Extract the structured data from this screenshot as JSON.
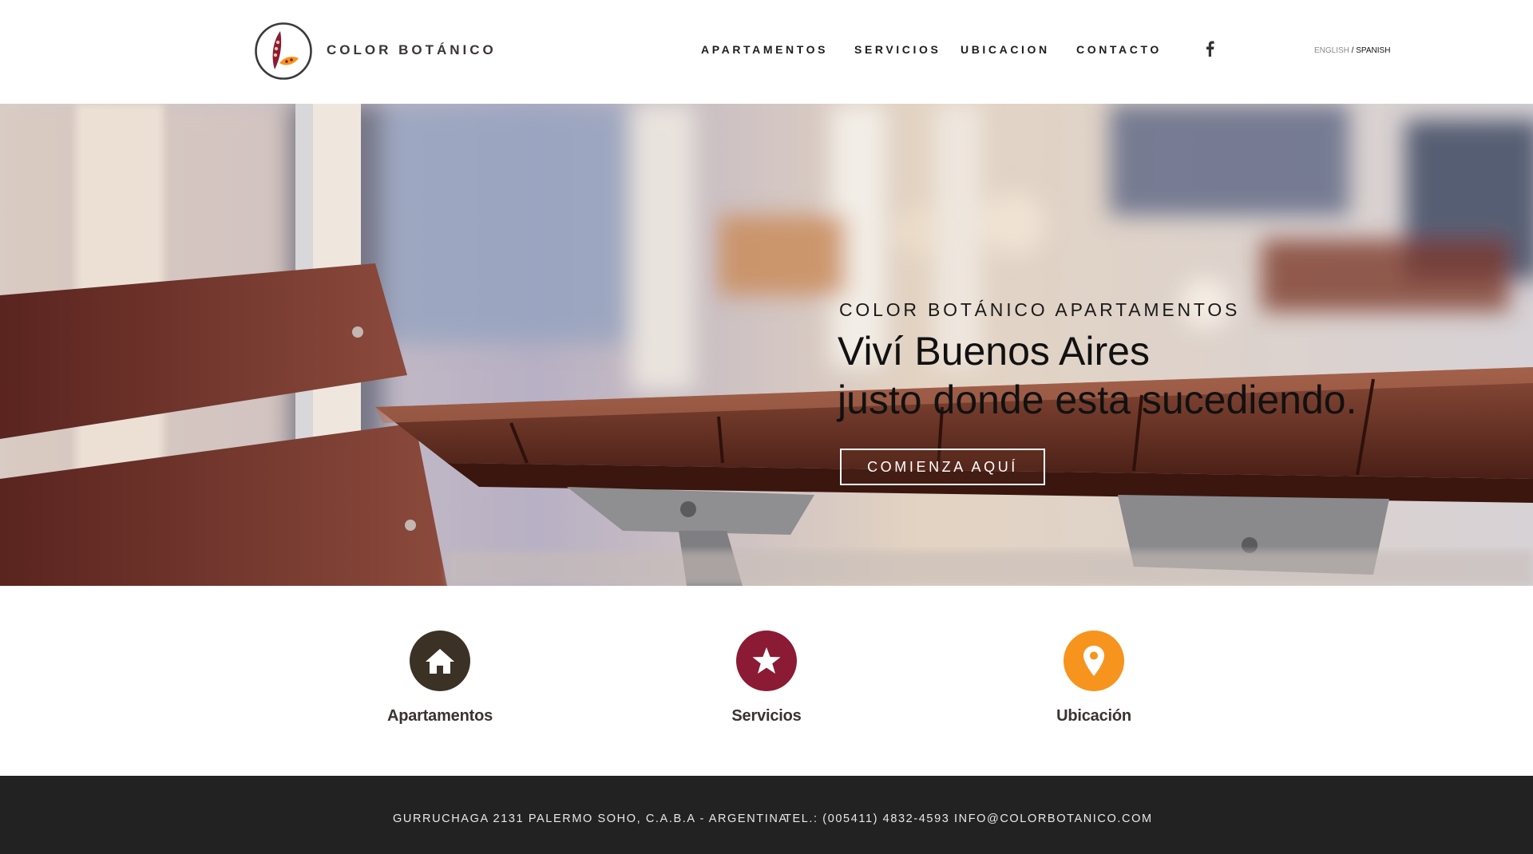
{
  "header": {
    "brand": "COLOR BOTÁNICO",
    "nav": [
      "APARTAMENTOS",
      "SERVICIOS",
      "UBICACION",
      "CONTACTO"
    ],
    "social_icon": "facebook-icon",
    "lang_english": "ENGLISH",
    "lang_separator": " / ",
    "lang_spanish": "SPANISH"
  },
  "hero": {
    "kicker": "COLOR BOTÁNICO APARTAMENTOS",
    "title_line1": "Viví Buenos Aires",
    "title_line2": "justo donde esta sucediendo.",
    "cta": "COMIENZA AQUÍ"
  },
  "features": [
    {
      "label": "Apartamentos",
      "icon": "home-icon",
      "color": "#3b3125"
    },
    {
      "label": "Servicios",
      "icon": "star-icon",
      "color": "#8b1a35"
    },
    {
      "label": "Ubicación",
      "icon": "map-pin-icon",
      "color": "#f7941d"
    }
  ],
  "footer": {
    "address": "GURRUCHAGA 2131  PALERMO SOHO, C.A.B.A  - ARGENTINA",
    "phone": "TEL.: (005411) 4832-4593",
    "email": "INFO@COLORBOTANICO.COM"
  },
  "colors": {
    "logo_red": "#8b1a35",
    "accent_orange": "#f7941d",
    "dark_brown": "#3b3125",
    "footer_bg": "#222222"
  }
}
